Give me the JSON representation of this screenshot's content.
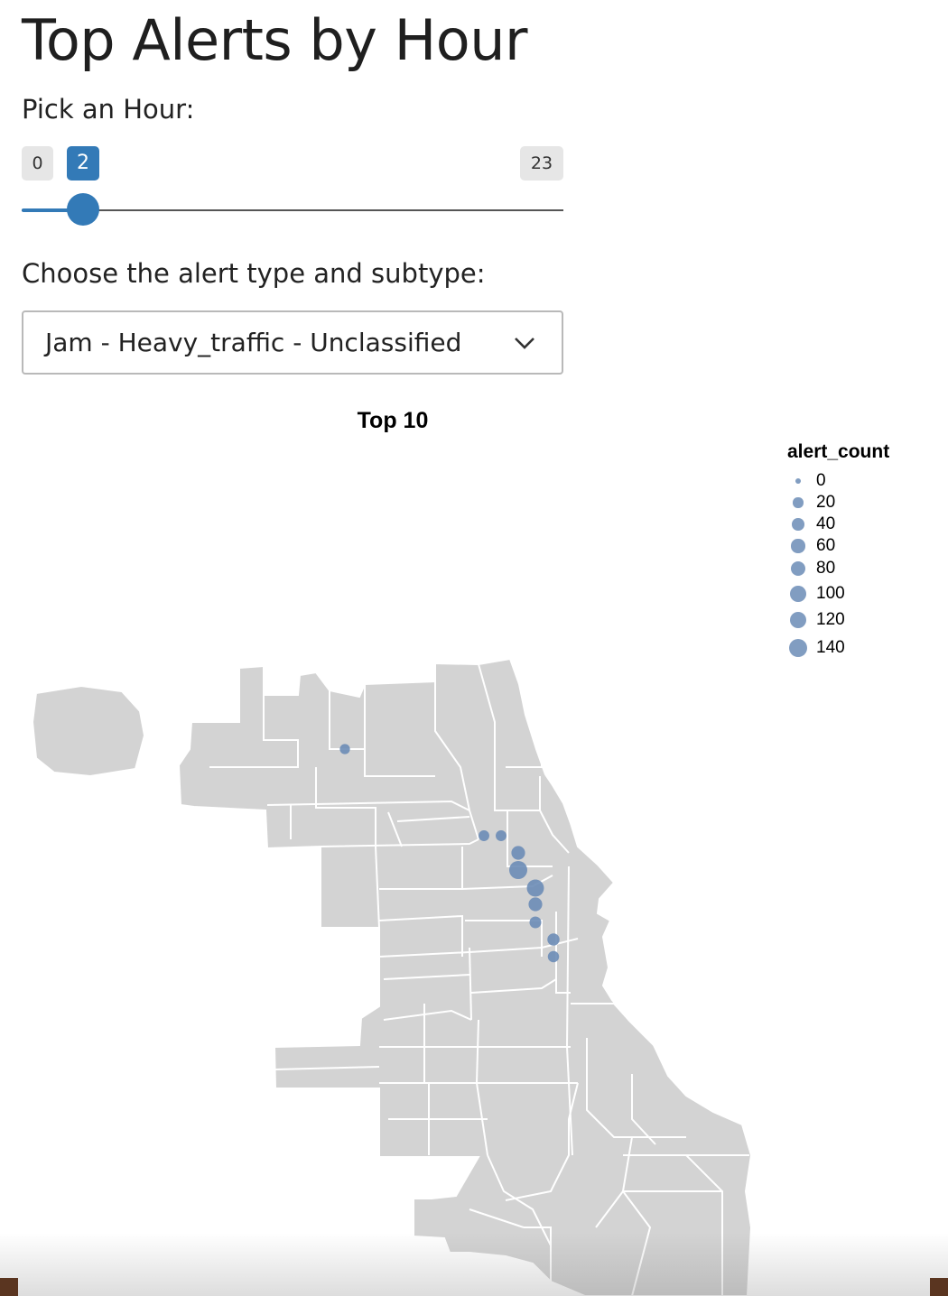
{
  "page": {
    "title": "Top Alerts by Hour"
  },
  "hour_slider": {
    "label": "Pick an Hour:",
    "min": "0",
    "max": "23",
    "value": "2"
  },
  "alert_type": {
    "label": "Choose the alert type and subtype:",
    "selected": "Jam - Heavy_traffic - Unclassified"
  },
  "colors": {
    "accent": "#337ab7",
    "map_fill": "#d3d3d3",
    "point": "#6b8cb6"
  },
  "chart_data": {
    "type": "scatter",
    "title": "Top 10",
    "base_map": "Chicago neighborhoods",
    "legend": {
      "title": "alert_count",
      "placement": "top-right",
      "entries": [
        0,
        20,
        40,
        60,
        80,
        100,
        120,
        140
      ]
    },
    "points": [
      {
        "alert_count": 20
      },
      {
        "alert_count": 25
      },
      {
        "alert_count": 25
      },
      {
        "alert_count": 60
      },
      {
        "alert_count": 140
      },
      {
        "alert_count": 120
      },
      {
        "alert_count": 60
      },
      {
        "alert_count": 35
      },
      {
        "alert_count": 40
      },
      {
        "alert_count": 30
      }
    ]
  }
}
